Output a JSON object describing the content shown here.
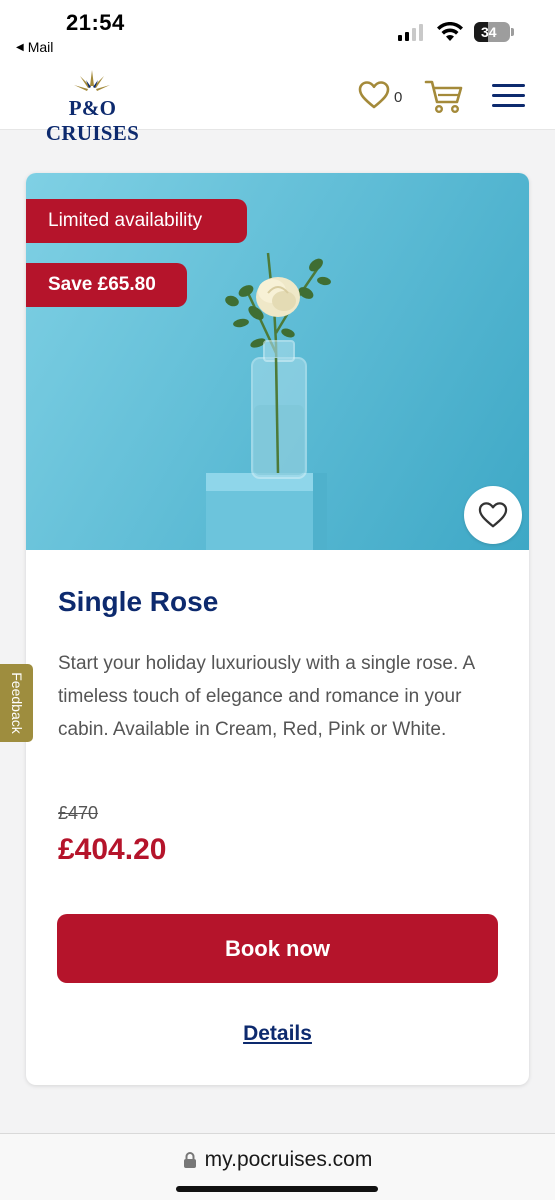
{
  "status_bar": {
    "time": "21:54",
    "back_app": "Mail",
    "battery": "34"
  },
  "header": {
    "brand": "P&O CRUISES",
    "wishlist_count": "0"
  },
  "product": {
    "badge_availability": "Limited availability",
    "badge_save": "Save £65.80",
    "title": "Single Rose",
    "description": "Start your holiday luxuriously with a single rose. A timeless touch of elegance and romance in your cabin. Available in Cream, Red, Pink or White.",
    "old_price": "£470",
    "new_price": "£404.20",
    "book_label": "Book now",
    "details_label": "Details"
  },
  "feedback_tab": "Feedback",
  "browser": {
    "url": "my.pocruises.com"
  },
  "colors": {
    "brand_navy": "#0d2a6e",
    "accent_red": "#b5142b",
    "gold": "#a48a3a"
  }
}
